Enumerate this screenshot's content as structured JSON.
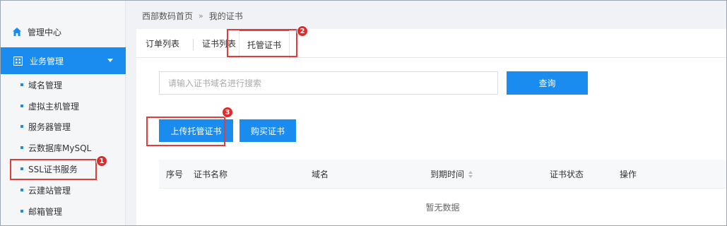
{
  "sidebar": {
    "home_label": "管理中心",
    "business_label": "业务管理",
    "items": [
      {
        "label": "域名管理"
      },
      {
        "label": "虚拟主机管理"
      },
      {
        "label": "服务器管理"
      },
      {
        "label": "云数据库MySQL"
      },
      {
        "label": "SSL证书服务"
      },
      {
        "label": "云建站管理"
      },
      {
        "label": "邮箱管理"
      }
    ]
  },
  "breadcrumb": {
    "home": "西部数码首页",
    "separator": "»",
    "current": "我的证书"
  },
  "tabs": [
    {
      "label": "订单列表"
    },
    {
      "label": "证书列表"
    },
    {
      "label": "托管证书",
      "active": true
    }
  ],
  "search": {
    "placeholder": "请输入证书域名进行搜索",
    "button_label": "查询"
  },
  "actions": {
    "upload_label": "上传托管证书",
    "buy_label": "购买证书"
  },
  "table": {
    "columns": [
      "序号",
      "证书名称",
      "域名",
      "到期时间",
      "证书状态",
      "操作"
    ],
    "empty_text": "暂无数据"
  },
  "annotations": [
    "1",
    "2",
    "3"
  ],
  "colors": {
    "accent": "#1a8cf0",
    "highlight": "#e33a3a"
  }
}
